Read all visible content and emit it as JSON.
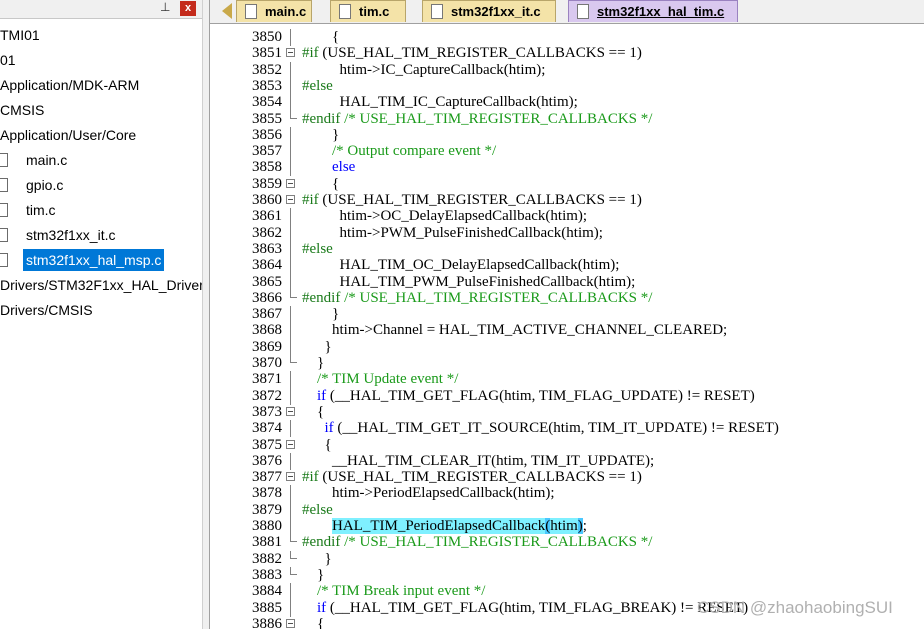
{
  "project_panel": {
    "pin_glyph": "⊥",
    "close_glyph": "x",
    "items": [
      {
        "label": "TMI01",
        "type": "group"
      },
      {
        "label": "01",
        "type": "group"
      },
      {
        "label": "Application/MDK-ARM",
        "type": "group"
      },
      {
        "label": "CMSIS",
        "type": "group"
      },
      {
        "label": "Application/User/Core",
        "type": "group"
      },
      {
        "label": "main.c",
        "type": "file"
      },
      {
        "label": "gpio.c",
        "type": "file"
      },
      {
        "label": "tim.c",
        "type": "file"
      },
      {
        "label": "stm32f1xx_it.c",
        "type": "file"
      },
      {
        "label": "stm32f1xx_hal_msp.c",
        "type": "file",
        "selected": true
      },
      {
        "label": "Drivers/STM32F1xx_HAL_Driver",
        "type": "group"
      },
      {
        "label": "Drivers/CMSIS",
        "type": "group"
      }
    ]
  },
  "tabs": [
    {
      "label": "main.c",
      "active": false
    },
    {
      "label": "tim.c",
      "active": false
    },
    {
      "label": "stm32f1xx_it.c",
      "active": false
    },
    {
      "label": "stm32f1xx_hal_tim.c",
      "active": true
    }
  ],
  "editor": {
    "lines": [
      {
        "n": "3850",
        "code": "        {"
      },
      {
        "n": "3851",
        "code": "#if (USE_HAL_TIM_REGISTER_CALLBACKS == 1)"
      },
      {
        "n": "3852",
        "code": "          htim->IC_CaptureCallback(htim);"
      },
      {
        "n": "3853",
        "code": "#else"
      },
      {
        "n": "3854",
        "code": "          HAL_TIM_IC_CaptureCallback(htim);"
      },
      {
        "n": "3855",
        "code": "#endif /* USE_HAL_TIM_REGISTER_CALLBACKS */"
      },
      {
        "n": "3856",
        "code": "        }"
      },
      {
        "n": "3857",
        "code": "        /* Output compare event */"
      },
      {
        "n": "3858",
        "code": "        else"
      },
      {
        "n": "3859",
        "code": "        {"
      },
      {
        "n": "3860",
        "code": "#if (USE_HAL_TIM_REGISTER_CALLBACKS == 1)"
      },
      {
        "n": "3861",
        "code": "          htim->OC_DelayElapsedCallback(htim);"
      },
      {
        "n": "3862",
        "code": "          htim->PWM_PulseFinishedCallback(htim);"
      },
      {
        "n": "3863",
        "code": "#else"
      },
      {
        "n": "3864",
        "code": "          HAL_TIM_OC_DelayElapsedCallback(htim);"
      },
      {
        "n": "3865",
        "code": "          HAL_TIM_PWM_PulseFinishedCallback(htim);"
      },
      {
        "n": "3866",
        "code": "#endif /* USE_HAL_TIM_REGISTER_CALLBACKS */"
      },
      {
        "n": "3867",
        "code": "        }"
      },
      {
        "n": "3868",
        "code": "        htim->Channel = HAL_TIM_ACTIVE_CHANNEL_CLEARED;"
      },
      {
        "n": "3869",
        "code": "      }"
      },
      {
        "n": "3870",
        "code": "    }"
      },
      {
        "n": "3871",
        "code": "    /* TIM Update event */"
      },
      {
        "n": "3872",
        "code": "    if (__HAL_TIM_GET_FLAG(htim, TIM_FLAG_UPDATE) != RESET)"
      },
      {
        "n": "3873",
        "code": "    {"
      },
      {
        "n": "3874",
        "code": "      if (__HAL_TIM_GET_IT_SOURCE(htim, TIM_IT_UPDATE) != RESET)"
      },
      {
        "n": "3875",
        "code": "      {"
      },
      {
        "n": "3876",
        "code": "        __HAL_TIM_CLEAR_IT(htim, TIM_IT_UPDATE);"
      },
      {
        "n": "3877",
        "code": "#if (USE_HAL_TIM_REGISTER_CALLBACKS == 1)"
      },
      {
        "n": "3878",
        "code": "        htim->PeriodElapsedCallback(htim);"
      },
      {
        "n": "3879",
        "code": "#else"
      },
      {
        "n": "3880",
        "code": "        HAL_TIM_PeriodElapsedCallback(htim);"
      },
      {
        "n": "3881",
        "code": "#endif /* USE_HAL_TIM_REGISTER_CALLBACKS */"
      },
      {
        "n": "3882",
        "code": "      }"
      },
      {
        "n": "3883",
        "code": "    }"
      },
      {
        "n": "3884",
        "code": "    /* TIM Break input event */"
      },
      {
        "n": "3885",
        "code": "    if (__HAL_TIM_GET_FLAG(htim, TIM_FLAG_BREAK) != RESET)"
      },
      {
        "n": "3886",
        "code": "    {"
      }
    ]
  },
  "watermark": "CSDN @zhaohaobingSUI",
  "colors": {
    "keyword": "#0000ff",
    "preprocessor": "#1a7a1a",
    "comment": "#1a9a1a",
    "highlight": "#7ff0ff",
    "selection": "#0078d7",
    "tab_inactive": "#f4e3a8",
    "tab_active": "#d9c8ef"
  }
}
